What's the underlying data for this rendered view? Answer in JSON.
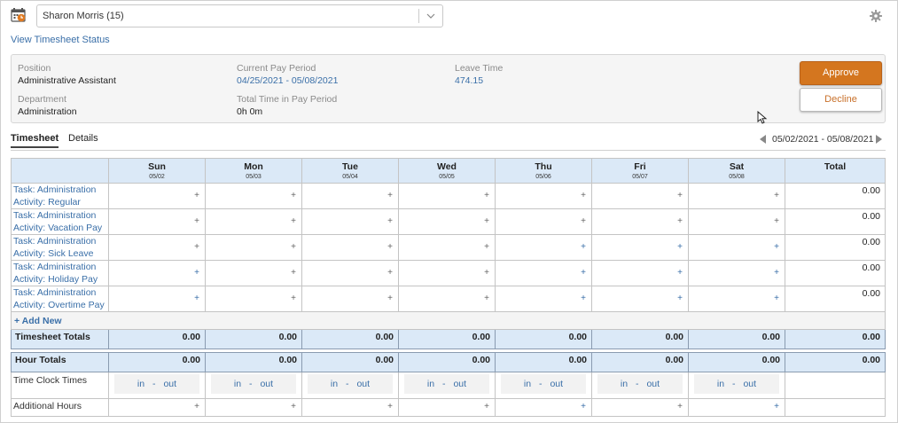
{
  "employee_select": {
    "value": "Sharon Morris (15)"
  },
  "view_status_link": "View Timesheet Status",
  "info": {
    "position_label": "Position",
    "position_value": "Administrative Assistant",
    "department_label": "Department",
    "department_value": "Administration",
    "pay_period_label": "Current Pay Period",
    "pay_period_value": "04/25/2021 - 05/08/2021",
    "total_time_label": "Total Time in Pay Period",
    "total_time_value": "0h 0m",
    "leave_label": "Leave Time",
    "leave_value": "474.15"
  },
  "actions": {
    "approve": "Approve",
    "decline": "Decline"
  },
  "tabs": [
    {
      "label": "Timesheet",
      "active": true
    },
    {
      "label": "Details",
      "active": false
    }
  ],
  "date_range": "05/02/2021 - 05/08/2021",
  "grid": {
    "days": [
      {
        "name": "Sun",
        "date": "05/02"
      },
      {
        "name": "Mon",
        "date": "05/03"
      },
      {
        "name": "Tue",
        "date": "05/04"
      },
      {
        "name": "Wed",
        "date": "05/05"
      },
      {
        "name": "Thu",
        "date": "05/06"
      },
      {
        "name": "Fri",
        "date": "05/07"
      },
      {
        "name": "Sat",
        "date": "05/08"
      }
    ],
    "total_header": "Total",
    "tasks": [
      {
        "task": "Task: Administration",
        "activity": "Activity: Regular",
        "total": "0.00"
      },
      {
        "task": "Task: Administration",
        "activity": "Activity: Vacation Pay",
        "total": "0.00"
      },
      {
        "task": "Task: Administration",
        "activity": "Activity: Sick Leave",
        "total": "0.00"
      },
      {
        "task": "Task: Administration",
        "activity": "Activity: Holiday Pay",
        "total": "0.00"
      },
      {
        "task": "Task: Administration",
        "activity": "Activity: Overtime Pay",
        "total": "0.00"
      }
    ],
    "add_new": "+ Add New",
    "timesheet_totals": {
      "label": "Timesheet Totals",
      "values": [
        "0.00",
        "0.00",
        "0.00",
        "0.00",
        "0.00",
        "0.00",
        "0.00",
        "0.00"
      ]
    },
    "hour_totals": {
      "label": "Hour Totals",
      "values": [
        "0.00",
        "0.00",
        "0.00",
        "0.00",
        "0.00",
        "0.00",
        "0.00",
        "0.00"
      ]
    },
    "time_clock": {
      "label": "Time Clock Times",
      "in": "in",
      "dash": "-",
      "out": "out"
    },
    "additional_hours": {
      "label": "Additional Hours"
    },
    "plus": "+"
  },
  "colors": {
    "accent_link": "#3a6fa8",
    "approve_bg": "#d4761f",
    "header_bg": "#dbe9f7"
  },
  "icons": {
    "app": "timesheet-calendar-icon",
    "settings": "gear-icon",
    "dropdown": "chevron-down-icon"
  }
}
